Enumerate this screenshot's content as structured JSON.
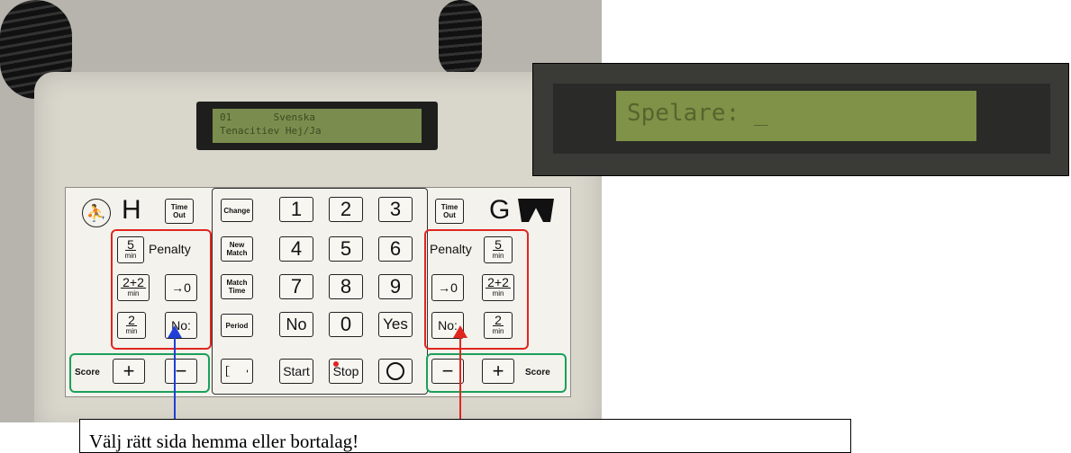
{
  "lcd_small": {
    "line1": "01       Svenska",
    "line2": "Tenacitiev Hej/Ja"
  },
  "lcd_inset": {
    "text": "Spelare: _"
  },
  "home": {
    "letter": "H",
    "timeout": [
      "Time",
      "Out"
    ],
    "penalty": "Penalty",
    "keys": {
      "five": "5",
      "twoplus": "2+2",
      "reset": "→0",
      "two": "2",
      "no": "No:",
      "min": "min"
    },
    "score": "Score"
  },
  "away": {
    "letter": "G",
    "timeout": [
      "Time",
      "Out"
    ],
    "penalty": "Penalty",
    "keys": {
      "five": "5",
      "twoplus": "2+2",
      "reset": "→0",
      "two": "2",
      "no": "No:",
      "min": "min"
    },
    "score": "Score"
  },
  "center": {
    "change": "Change",
    "new_match": [
      "New",
      "Match"
    ],
    "match_time": [
      "Match",
      "Time"
    ],
    "period": "Period",
    "digits": [
      "1",
      "2",
      "3",
      "4",
      "5",
      "6",
      "7",
      "8",
      "9",
      "No",
      "0",
      "Yes"
    ],
    "start": "Start",
    "stop": "Stop"
  },
  "signs": {
    "plus": "+",
    "minus": "−"
  },
  "callout": "Välj rätt sida hemma eller bortalag!",
  "colors": {
    "red_box": "#e0261f",
    "green_box": "#1aa05a",
    "arrow_left": "#1f3fd8",
    "arrow_right": "#e0261f",
    "lcd": "#7f9247"
  }
}
